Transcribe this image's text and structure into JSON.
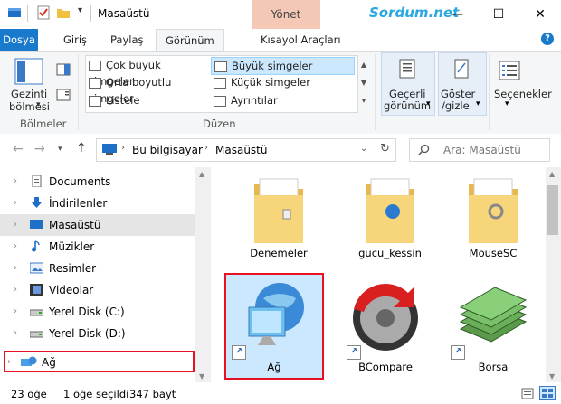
{
  "title_bar": {
    "title": "Masaüstü",
    "context_tab": "Yönet",
    "watermark": "Sordum.net",
    "minimize": "—",
    "maximize": "☐",
    "close": "✕"
  },
  "ribbon_tabs": [
    "Dosya",
    "Giriş",
    "Paylaş",
    "Görünüm",
    "Kısayol Araçları"
  ],
  "ribbon": {
    "panes": {
      "label_line1": "Gezinti",
      "label_line2": "bölmesi",
      "group": "Bölmeler"
    },
    "layout": {
      "group": "Düzen",
      "items": [
        "Çok büyük simgeler",
        "Büyük simgeler",
        "Orta boyutlu simgeler",
        "Küçük simgeler",
        "Listele",
        "Ayrıntılar"
      ]
    },
    "current_view": {
      "line1": "Geçerli",
      "line2": "görünüm"
    },
    "show_hide": {
      "line1": "Göster",
      "line2": "/gizle"
    },
    "options": "Seçenekler"
  },
  "address": {
    "crumbs": [
      "Bu bilgisayar",
      "Masaüstü"
    ],
    "search_placeholder": "Ara: Masaüstü"
  },
  "nav_items": [
    {
      "label": "Documents",
      "icon": "documents-icon"
    },
    {
      "label": "İndirilenler",
      "icon": "download-arrow-icon"
    },
    {
      "label": "Masaüstü",
      "icon": "desktop-icon"
    },
    {
      "label": "Müzikler",
      "icon": "music-note-icon"
    },
    {
      "label": "Resimler",
      "icon": "pictures-icon"
    },
    {
      "label": "Videolar",
      "icon": "film-icon"
    },
    {
      "label": "Yerel Disk (C:)",
      "icon": "drive-icon"
    },
    {
      "label": "Yerel Disk (D:)",
      "icon": "drive-icon"
    },
    {
      "label": "Ağ",
      "icon": "network-icon"
    }
  ],
  "files": [
    {
      "label": "Denemeler"
    },
    {
      "label": "gucu_kessin"
    },
    {
      "label": "MouseSC"
    },
    {
      "label": "Ağ"
    },
    {
      "label": "BCompare"
    },
    {
      "label": "Borsa"
    }
  ],
  "status": {
    "count": "23 öğe",
    "selected": "1 öğe seçildi",
    "size": "347 bayt"
  },
  "colors": {
    "accent": "#1979ca",
    "highlight_red": "#e81123",
    "selection": "#cce8ff"
  }
}
